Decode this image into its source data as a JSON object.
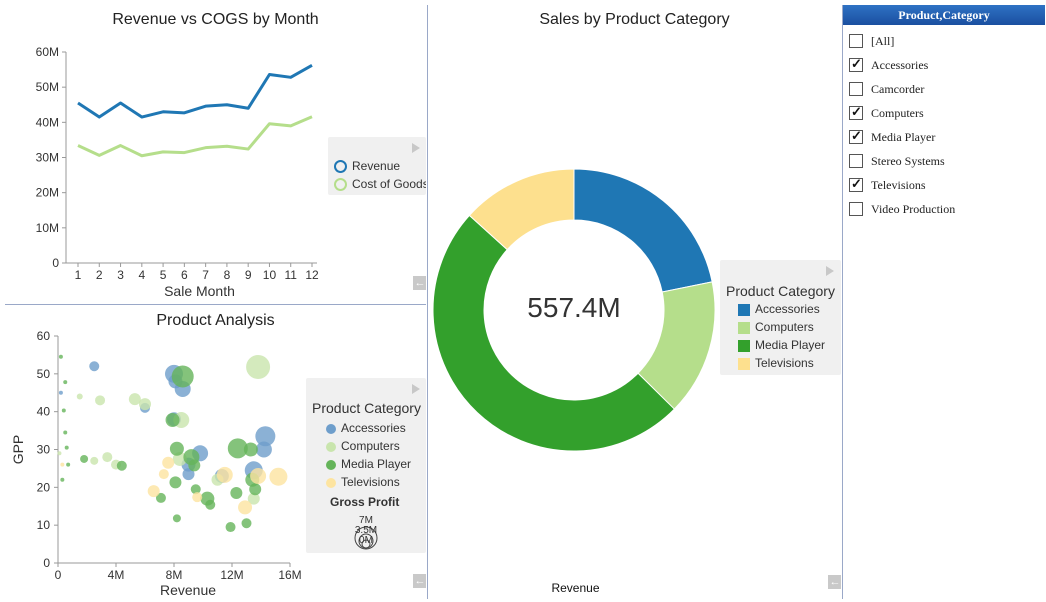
{
  "chart_data": [
    {
      "type": "line",
      "title": "Revenue vs COGS by Month",
      "xlabel": "Sale Month",
      "ylabel": "",
      "x": [
        1,
        2,
        3,
        4,
        5,
        6,
        7,
        8,
        9,
        10,
        11,
        12
      ],
      "x_ticks": [
        "1",
        "2",
        "3",
        "4",
        "5",
        "6",
        "7",
        "8",
        "9",
        "10",
        "11",
        "12"
      ],
      "y_ticks": [
        "0",
        "10M",
        "20M",
        "30M",
        "40M",
        "50M",
        "60M"
      ],
      "ylim": [
        0,
        60000000
      ],
      "series": [
        {
          "name": "Revenue",
          "color": "#1f77b4",
          "values": [
            45.5,
            41.5,
            45.5,
            41.5,
            43,
            42.7,
            44.6,
            45,
            44,
            53.6,
            52.8,
            56.2
          ]
        },
        {
          "name": "Cost of Goods",
          "color": "#b5de8b",
          "values": [
            33.4,
            30.6,
            33.4,
            30.5,
            31.6,
            31.4,
            32.8,
            33.2,
            32.4,
            39.6,
            39,
            41.6
          ]
        }
      ],
      "value_unit": "M",
      "legend_position": "right"
    },
    {
      "type": "pie",
      "title": "Sales by Product Category",
      "center_label": "557.4M",
      "bottom_label": "Revenue",
      "legend_title": "Product Category",
      "slices": [
        {
          "name": "Accessories",
          "value": 21.8,
          "color": "#1f77b4"
        },
        {
          "name": "Computers",
          "value": 15.6,
          "color": "#b5de8b"
        },
        {
          "name": "Media Player",
          "value": 49.3,
          "color": "#33a02c"
        },
        {
          "name": "Televisions",
          "value": 13.3,
          "color": "#fde08e"
        }
      ],
      "legend_position": "right"
    },
    {
      "type": "scatter",
      "title": "Product Analysis",
      "xlabel": "Revenue",
      "ylabel": "GPP",
      "x_ticks": [
        "0",
        "4M",
        "8M",
        "12M",
        "16M"
      ],
      "y_ticks": [
        "0",
        "10",
        "20",
        "30",
        "40",
        "50",
        "60"
      ],
      "xlim": [
        0,
        16
      ],
      "ylim": [
        0,
        60
      ],
      "legend_title": "Product Category",
      "size_legend_title": "Gross Profit",
      "size_legend_labels": [
        "7M",
        "3.5M",
        "0M"
      ],
      "series": [
        {
          "name": "Accessories",
          "color": "#6e9ecb",
          "points": [
            [
              2.5,
              52,
              5
            ],
            [
              8,
              50,
              9
            ],
            [
              8.1,
              48,
              7
            ],
            [
              8.6,
              46,
              8
            ],
            [
              8,
              38,
              7
            ],
            [
              9.8,
              29,
              8
            ],
            [
              9,
              26,
              7
            ],
            [
              9,
              23.5,
              6
            ],
            [
              14.3,
              33.5,
              10
            ],
            [
              14.2,
              30,
              8
            ],
            [
              13.5,
              24.5,
              9
            ],
            [
              11.3,
              23,
              7
            ],
            [
              6,
              41,
              5
            ],
            [
              0.2,
              45,
              2
            ]
          ]
        },
        {
          "name": "Computers",
          "color": "#c9e5ad",
          "points": [
            [
              13.8,
              51.8,
              12
            ],
            [
              5.3,
              43.3,
              6
            ],
            [
              6,
              42,
              6
            ],
            [
              8.5,
              37.8,
              8
            ],
            [
              1.5,
              44,
              3
            ],
            [
              2.9,
              43,
              5
            ],
            [
              3.4,
              28,
              5
            ],
            [
              2.5,
              27,
              4
            ],
            [
              4,
              26,
              5
            ],
            [
              8.4,
              27.5,
              7
            ],
            [
              11,
              22,
              6
            ],
            [
              0.1,
              29,
              2
            ],
            [
              13.5,
              17,
              6
            ]
          ]
        },
        {
          "name": "Media Player",
          "color": "#65b45a",
          "points": [
            [
              8.6,
              49.3,
              11
            ],
            [
              7.9,
              37.8,
              7
            ],
            [
              8.2,
              30.2,
              7
            ],
            [
              9.2,
              28,
              8
            ],
            [
              9.4,
              25.8,
              6
            ],
            [
              12.4,
              30.3,
              10
            ],
            [
              13.3,
              30,
              7
            ],
            [
              12.3,
              18.5,
              6
            ],
            [
              13.6,
              19.5,
              6
            ],
            [
              13.4,
              22,
              7
            ],
            [
              10.3,
              17,
              7
            ],
            [
              10.5,
              15.4,
              5
            ],
            [
              7.1,
              17.2,
              5
            ],
            [
              8.1,
              21.3,
              6
            ],
            [
              9.5,
              19.5,
              5
            ],
            [
              8.2,
              11.8,
              4
            ],
            [
              11.9,
              9.5,
              5
            ],
            [
              13,
              10.5,
              5
            ],
            [
              4.4,
              25.7,
              5
            ],
            [
              1.8,
              27.5,
              4
            ],
            [
              0.4,
              40.3,
              2
            ],
            [
              0.5,
              34.5,
              2
            ],
            [
              0.6,
              30.5,
              2
            ],
            [
              0.7,
              26,
              2
            ],
            [
              0.5,
              47.8,
              2
            ],
            [
              0.2,
              54.5,
              2
            ],
            [
              0.3,
              22,
              2
            ]
          ]
        },
        {
          "name": "Televisions",
          "color": "#fde4a0",
          "points": [
            [
              15.2,
              22.8,
              9
            ],
            [
              11.5,
              23.3,
              8
            ],
            [
              13.8,
              23,
              8
            ],
            [
              7.6,
              26.5,
              6
            ],
            [
              6.6,
              19,
              6
            ],
            [
              7.3,
              23.5,
              5
            ],
            [
              9.6,
              17.4,
              5
            ],
            [
              12.9,
              14.7,
              7
            ],
            [
              0.3,
              26,
              2
            ]
          ]
        }
      ],
      "legend_position": "right"
    }
  ],
  "filter": {
    "header": "Product,Category",
    "items": [
      {
        "label": "[All]",
        "checked": false
      },
      {
        "label": "Accessories",
        "checked": true
      },
      {
        "label": "Camcorder",
        "checked": false
      },
      {
        "label": "Computers",
        "checked": true
      },
      {
        "label": "Media Player",
        "checked": true
      },
      {
        "label": "Stereo Systems",
        "checked": false
      },
      {
        "label": "Televisions",
        "checked": true
      },
      {
        "label": "Video Production",
        "checked": false
      }
    ]
  },
  "icons": {
    "back": "back-arrow-icon",
    "expand": "expand-triangle-icon",
    "check": "✓"
  },
  "colors": {
    "panel_border": "#9aa8c8",
    "legend_bg": "#f0f0f0"
  }
}
